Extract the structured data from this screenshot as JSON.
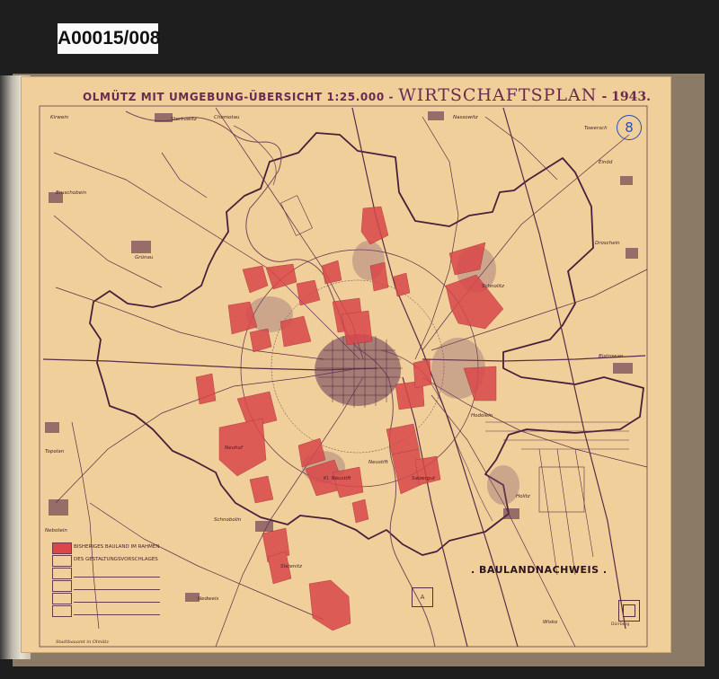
{
  "archive_label": "A00015/008",
  "title": {
    "part1": "OLMÜTZ MIT UMGEBUNG-ÜBERSICHT 1:25.000 -",
    "part2": "WIRTSCHAFTSPLAN",
    "part3": "- 1943."
  },
  "sheet_number": "8",
  "map_title": ". BAULANDNACHWEIS .",
  "legend": {
    "item1": "BISHERIGES BAULAND IM RAHMEN",
    "item2": "DES GESTALTUNGSVORSCHLAGES"
  },
  "signature": "Stadtbauamt in Olmütz",
  "compass_label": "Dürrberg",
  "a_mark": "A",
  "places": {
    "kirwein": "Kirwein",
    "storkowitz": "Storkowitz",
    "chomotau": "Chomotau",
    "nassowitz": "Nassowitz",
    "towersch": "Towersch",
    "einod": "Einöd",
    "bruschobein": "Bruschobein",
    "grunau": "Grünau",
    "droschein": "Droschein",
    "bistrowan": "Bistrowan",
    "topolan": "Topolan",
    "nebotein": "Nebotein",
    "schnobolin": "Schnobolin",
    "slatenitz": "Slatenitz",
    "hodolein": "Hodolein",
    "holitz": "Holitz",
    "nedweis": "Nedweis",
    "wisko": "Wisko",
    "neustift": "Neustift",
    "salzergut": "Salzergut",
    "neuhof": "Neuhof",
    "schnolitz": "Schnolitz",
    "kl_neustift": "Kl. Neustift"
  },
  "colors": {
    "paper": "#f0cf9a",
    "ink": "#5e2a48",
    "baulnd_red": "#d9474a",
    "border": "#5a2a40",
    "sheet_circle": "#2b4fb5"
  }
}
